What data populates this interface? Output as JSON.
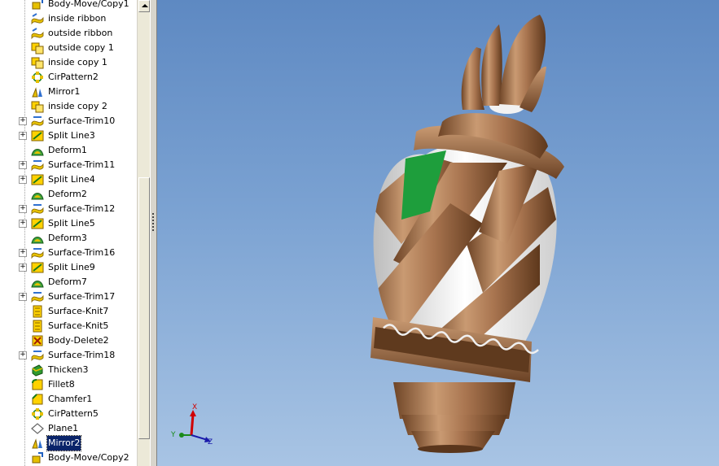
{
  "feature_tree": {
    "items": [
      {
        "label": "Body-Move/Copy1",
        "icon": "body-move-icon",
        "expandable": false
      },
      {
        "label": "inside ribbon",
        "icon": "surface-icon",
        "expandable": false
      },
      {
        "label": "outside ribbon",
        "icon": "surface-icon",
        "expandable": false
      },
      {
        "label": "outside copy 1",
        "icon": "copy-icon",
        "expandable": false
      },
      {
        "label": "inside copy 1",
        "icon": "copy-icon",
        "expandable": false
      },
      {
        "label": "CirPattern2",
        "icon": "circular-pattern-icon",
        "expandable": false
      },
      {
        "label": "Mirror1",
        "icon": "mirror-icon",
        "expandable": false
      },
      {
        "label": "inside copy 2",
        "icon": "copy-icon",
        "expandable": false
      },
      {
        "label": "Surface-Trim10",
        "icon": "surface-trim-icon",
        "expandable": true
      },
      {
        "label": "Split Line3",
        "icon": "split-line-icon",
        "expandable": true
      },
      {
        "label": "Deform1",
        "icon": "deform-icon",
        "expandable": false
      },
      {
        "label": "Surface-Trim11",
        "icon": "surface-trim-icon",
        "expandable": true
      },
      {
        "label": "Split Line4",
        "icon": "split-line-icon",
        "expandable": true
      },
      {
        "label": "Deform2",
        "icon": "deform-icon",
        "expandable": false
      },
      {
        "label": "Surface-Trim12",
        "icon": "surface-trim-icon",
        "expandable": true
      },
      {
        "label": "Split Line5",
        "icon": "split-line-icon",
        "expandable": true
      },
      {
        "label": "Deform3",
        "icon": "deform-icon",
        "expandable": false
      },
      {
        "label": "Surface-Trim16",
        "icon": "surface-trim-icon",
        "expandable": true
      },
      {
        "label": "Split Line9",
        "icon": "split-line-icon",
        "expandable": true
      },
      {
        "label": "Deform7",
        "icon": "deform-icon",
        "expandable": false
      },
      {
        "label": "Surface-Trim17",
        "icon": "surface-trim-icon",
        "expandable": true
      },
      {
        "label": "Surface-Knit7",
        "icon": "surface-knit-icon",
        "expandable": false
      },
      {
        "label": "Surface-Knit5",
        "icon": "surface-knit-icon",
        "expandable": false
      },
      {
        "label": "Body-Delete2",
        "icon": "body-delete-icon",
        "expandable": false
      },
      {
        "label": "Surface-Trim18",
        "icon": "surface-trim-icon",
        "expandable": true
      },
      {
        "label": "Thicken3",
        "icon": "thicken-icon",
        "expandable": false
      },
      {
        "label": "Fillet8",
        "icon": "fillet-icon",
        "expandable": false
      },
      {
        "label": "Chamfer1",
        "icon": "chamfer-icon",
        "expandable": false
      },
      {
        "label": "CirPattern5",
        "icon": "circular-pattern-icon",
        "expandable": false
      },
      {
        "label": "Plane1",
        "icon": "plane-icon",
        "expandable": false
      },
      {
        "label": "Mirror2",
        "icon": "mirror-icon",
        "expandable": false,
        "selected": true
      },
      {
        "label": "Body-Move/Copy2",
        "icon": "body-move-icon",
        "expandable": false
      }
    ]
  },
  "triad": {
    "x_label": "X",
    "y_label": "Y",
    "z_label": "Z"
  },
  "colors": {
    "viewport_top": "#5e89c2",
    "viewport_bottom": "#a8c4e4",
    "selected_face": "#1e9e3c",
    "bronze": "#a8744f",
    "white_ribbon": "#f2f2f2",
    "selection": "#0a246a"
  }
}
